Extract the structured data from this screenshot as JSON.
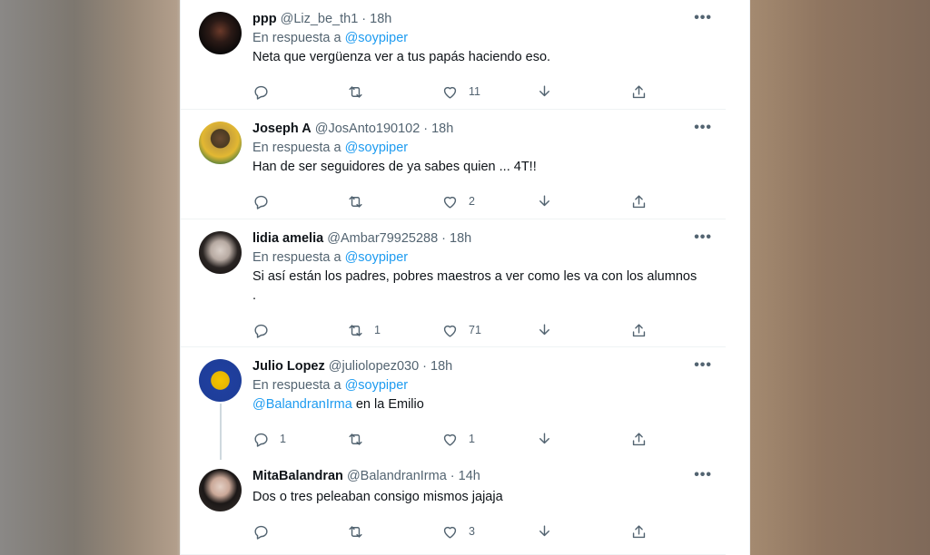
{
  "replying_prefix": "En respuesta a",
  "tweets": [
    {
      "name": "ppp",
      "handle": "@Liz_be_th1",
      "time": "18h",
      "reply_to": "@soypiper",
      "text": "Neta que vergüenza ver a tus papás haciendo eso.",
      "replies": "",
      "retweets": "",
      "likes": "11"
    },
    {
      "name": "Joseph A",
      "handle": "@JosAnto190102",
      "time": "18h",
      "reply_to": "@soypiper",
      "text": "Han de ser seguidores de ya sabes quien ... 4T!!",
      "replies": "",
      "retweets": "",
      "likes": "2"
    },
    {
      "name": "lidia amelia",
      "handle": "@Ambar79925288",
      "time": "18h",
      "reply_to": "@soypiper",
      "text": "Si así están los padres, pobres maestros a ver como les va con los alumnos\n.",
      "replies": "",
      "retweets": "1",
      "likes": "71"
    },
    {
      "name": "Julio Lopez",
      "handle": "@juliolopez030",
      "time": "18h",
      "reply_to": "@soypiper",
      "mention": "@BalandranIrma",
      "text": "en la Emilio",
      "replies": "1",
      "retweets": "",
      "likes": "1"
    },
    {
      "name": "MitaBalandran",
      "handle": "@BalandranIrma",
      "time": "14h",
      "text": "Dos o tres peleaban consigo mismos jajaja",
      "replies": "",
      "retweets": "",
      "likes": "3"
    }
  ],
  "colors": {
    "accent": "#1d9bf0",
    "text": "#0f1419",
    "muted": "#536471"
  }
}
